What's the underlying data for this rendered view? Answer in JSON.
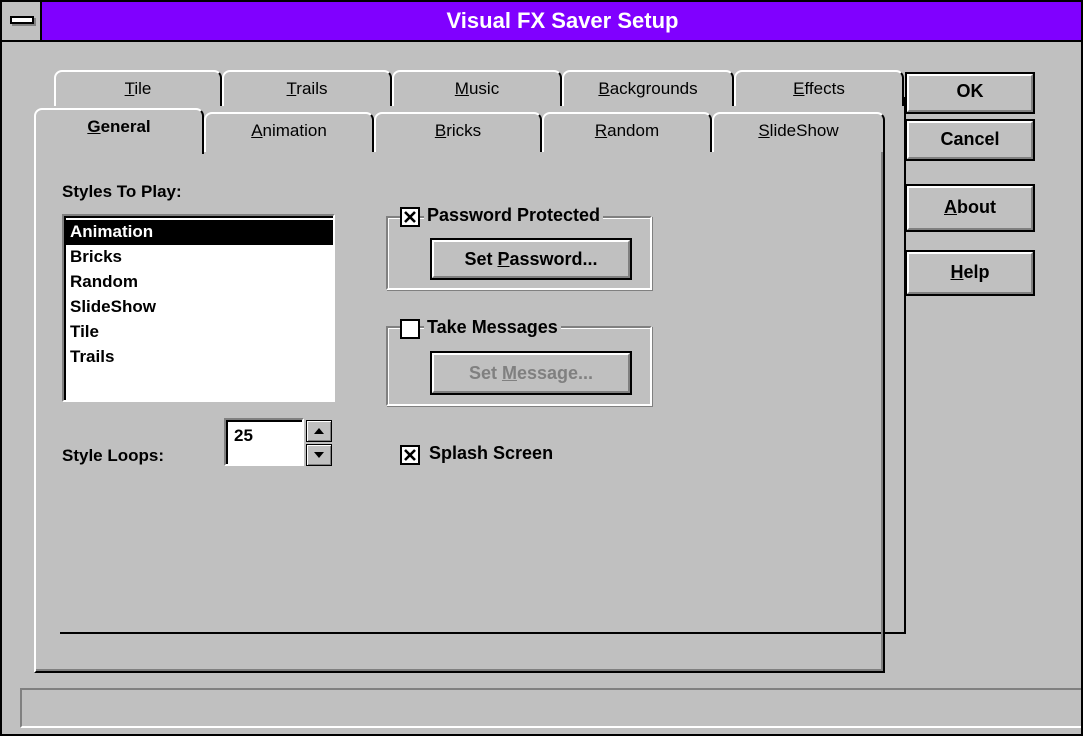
{
  "window": {
    "title": "Visual FX Saver Setup"
  },
  "tabs": {
    "back_row": [
      {
        "label_pre": "",
        "mnemonic": "T",
        "label_post": "ile"
      },
      {
        "label_pre": "",
        "mnemonic": "T",
        "label_post": "rails"
      },
      {
        "label_pre": "",
        "mnemonic": "M",
        "label_post": "usic"
      },
      {
        "label_pre": "",
        "mnemonic": "B",
        "label_post": "ackgrounds"
      },
      {
        "label_pre": "",
        "mnemonic": "E",
        "label_post": "ffects"
      }
    ],
    "front_row": [
      {
        "label_pre": "",
        "mnemonic": "G",
        "label_post": "eneral",
        "active": true
      },
      {
        "label_pre": "",
        "mnemonic": "A",
        "label_post": "nimation"
      },
      {
        "label_pre": "",
        "mnemonic": "B",
        "label_post": "ricks"
      },
      {
        "label_pre": "",
        "mnemonic": "R",
        "label_post": "andom"
      },
      {
        "label_pre": "",
        "mnemonic": "S",
        "label_post": "lideShow"
      }
    ]
  },
  "buttons": {
    "ok": "OK",
    "cancel": "Cancel",
    "about_mn": "A",
    "about_rest": "bout",
    "help_mn": "H",
    "help_rest": "elp"
  },
  "general": {
    "styles_label": "Styles To Play:",
    "styles": [
      "Animation",
      "Bricks",
      "Random",
      "SlideShow",
      "Tile",
      "Trails"
    ],
    "selected_style": "Animation",
    "loops_label": "Style Loops:",
    "loops_value": "25",
    "password": {
      "label": "Password Protected",
      "checked": true,
      "button_pre": "Set ",
      "button_mn": "P",
      "button_post": "assword..."
    },
    "messages": {
      "label": "Take Messages",
      "checked": false,
      "button_pre": "Set ",
      "button_mn": "M",
      "button_post": "essage...",
      "button_enabled": false
    },
    "splash": {
      "label": "Splash Screen",
      "checked": true
    }
  },
  "status": {
    "text": ""
  }
}
